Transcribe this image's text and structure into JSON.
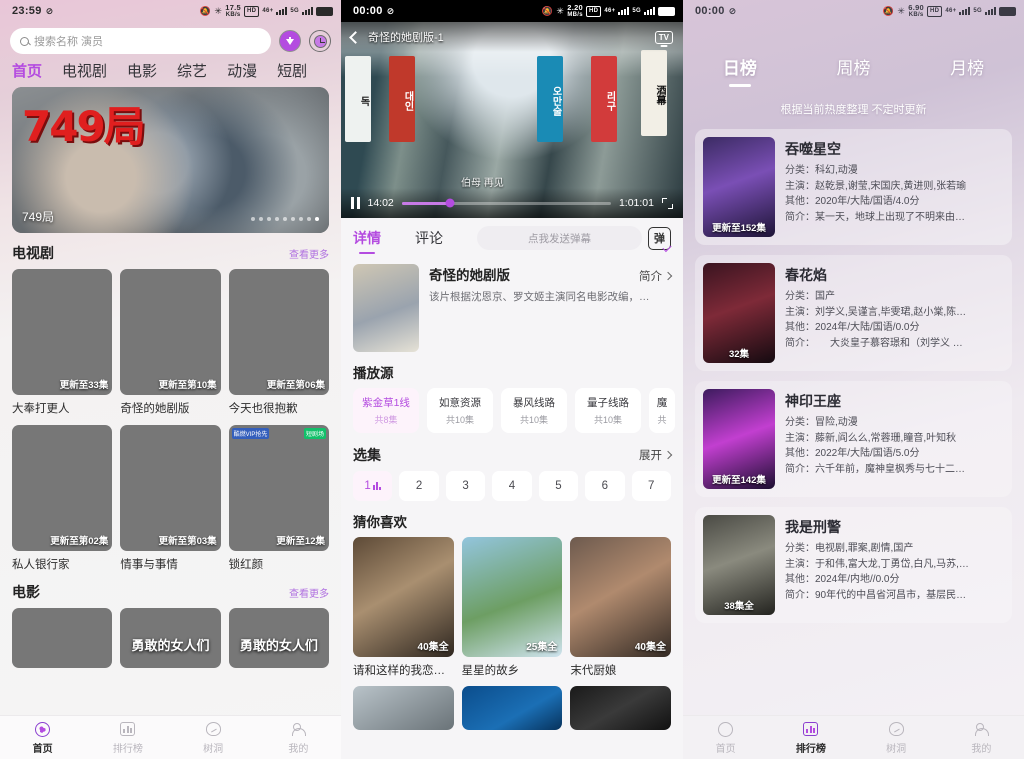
{
  "home": {
    "status": {
      "time": "23:59",
      "speed_value": "17.5",
      "speed_unit": "KB/s",
      "hd": "HD",
      "sig1": "46+",
      "sig2": "5G"
    },
    "search": {
      "placeholder": "搜索名称 演员"
    },
    "icons": {
      "download": "download-circle-icon",
      "history": "history-clock-icon"
    },
    "tabs": [
      {
        "label": "首页",
        "active": true
      },
      {
        "label": "电视剧",
        "active": false
      },
      {
        "label": "电影",
        "active": false
      },
      {
        "label": "综艺",
        "active": false
      },
      {
        "label": "动漫",
        "active": false
      },
      {
        "label": "短剧",
        "active": false
      }
    ],
    "banner": {
      "logo": "749局",
      "caption": "749局",
      "dots_total": 9,
      "dots_active_index": 8
    },
    "sections": [
      {
        "title": "电视剧",
        "more": "查看更多",
        "rows": [
          [
            {
              "name": "大奉打更人",
              "badge": "更新至33集",
              "corner": "",
              "corner_right": ""
            },
            {
              "name": "奇怪的她剧版",
              "badge": "更新至第10集",
              "corner": "",
              "corner_right": ""
            },
            {
              "name": "今天也很抱歉",
              "badge": "更新至第06集",
              "corner": "",
              "corner_right": ""
            }
          ],
          [
            {
              "name": "私人银行家",
              "badge": "更新至第02集",
              "corner": "",
              "corner_right": ""
            },
            {
              "name": "情事与事情",
              "badge": "更新至第03集",
              "corner": "",
              "corner_right": ""
            },
            {
              "name": "锁红颜",
              "badge": "更新至12集",
              "corner": "酷燃VIP抢先",
              "corner_right": "短剧场"
            }
          ]
        ]
      },
      {
        "title": "电影",
        "more": "查看更多",
        "rows": [
          [
            {
              "name": "",
              "badge": "",
              "corner": "",
              "corner_right": ""
            },
            {
              "name": "",
              "badge": "",
              "corner": "",
              "corner_right": "",
              "poster_title": "勇敢的女人们"
            },
            {
              "name": "",
              "badge": "",
              "corner": "",
              "corner_right": "",
              "poster_title": "勇敢的女人们"
            }
          ]
        ]
      }
    ],
    "tabbar": [
      {
        "label": "首页",
        "icon": "home-icon",
        "active": true
      },
      {
        "label": "排行榜",
        "icon": "chart-icon",
        "active": false
      },
      {
        "label": "树洞",
        "icon": "tree-hole-icon",
        "active": false
      },
      {
        "label": "我的",
        "icon": "user-icon",
        "active": false
      }
    ]
  },
  "player": {
    "status": {
      "time": "00:00",
      "speed_value": "2.20",
      "speed_unit": "MB/s",
      "hd": "HD",
      "sig1": "46+",
      "sig2": "5G"
    },
    "video": {
      "title": "奇怪的她剧版-1",
      "cast_label": "TV",
      "danmaku_overlay": "伯母 再见",
      "current_time": "14:02",
      "duration": "1:01:01",
      "progress_percent": 23,
      "state": "paused"
    },
    "tabs": [
      {
        "label": "详情",
        "active": true
      },
      {
        "label": "评论",
        "active": false
      }
    ],
    "danmaku_input": {
      "placeholder": "点我发送弹幕",
      "button": "弹"
    },
    "show": {
      "title": "奇怪的她剧版",
      "more_label": "简介",
      "desc": "该片根据沈恩京、罗文姬主演同名电影改编，…"
    },
    "sources": {
      "title": "播放源",
      "items": [
        {
          "name": "紫金草1线",
          "count": "共8集",
          "selected": true
        },
        {
          "name": "如意资源",
          "count": "共10集",
          "selected": false
        },
        {
          "name": "暴风线路",
          "count": "共10集",
          "selected": false
        },
        {
          "name": "量子线路",
          "count": "共10集",
          "selected": false
        },
        {
          "name": "魔",
          "count": "共",
          "selected": false
        }
      ]
    },
    "episodes": {
      "title": "选集",
      "expand_label": "展开",
      "items": [
        {
          "label": "1",
          "playing": true
        },
        {
          "label": "2",
          "playing": false
        },
        {
          "label": "3",
          "playing": false
        },
        {
          "label": "4",
          "playing": false
        },
        {
          "label": "5",
          "playing": false
        },
        {
          "label": "6",
          "playing": false
        },
        {
          "label": "7",
          "playing": false
        }
      ]
    },
    "recommend": {
      "title": "猜你喜欢",
      "items": [
        {
          "name": "请和这样的我恋…",
          "badge": "40集全"
        },
        {
          "name": "星星的故乡",
          "badge": "25集全"
        },
        {
          "name": "末代厨娘",
          "badge": "40集全"
        }
      ]
    }
  },
  "ranking": {
    "status": {
      "time": "00:00",
      "speed_value": "6.90",
      "speed_unit": "KB/s",
      "hd": "HD",
      "sig1": "46+",
      "sig2": "5G"
    },
    "tabs": [
      {
        "label": "日榜",
        "active": true
      },
      {
        "label": "周榜",
        "active": false
      },
      {
        "label": "月榜",
        "active": false
      }
    ],
    "subtitle": "根据当前热度整理 不定时更新",
    "labels": {
      "category": "分类：",
      "cast": "主演：",
      "other": "其他：",
      "summary": "简介："
    },
    "items": [
      {
        "title": "吞噬星空",
        "episode_badge": "更新至152集",
        "category": "科幻,动漫",
        "cast": "赵乾景,谢莹,宋国庆,黄进则,张若瑜",
        "other": "2020年/大陆/国语/4.0分",
        "summary": "某一天，地球上出现了不明来由…"
      },
      {
        "title": "春花焰",
        "episode_badge": "32集",
        "category": "国产",
        "cast": "刘学义,吴谨言,毕雯珺,赵小棠,陈…",
        "other": "2024年/大陆/国语/0.0分",
        "summary": "　　大炎皇子慕容璟和（刘学义 …"
      },
      {
        "title": "神印王座",
        "episode_badge": "更新至142集",
        "category": "冒险,动漫",
        "cast": "藤新,阎么么,常蓉珊,瞳音,叶知秋",
        "other": "2022年/大陆/国语/5.0分",
        "summary": "六千年前，魔神皇枫秀与七十二…"
      },
      {
        "title": "我是刑警",
        "episode_badge": "38集全",
        "category": "电视剧,罪案,剧情,国产",
        "cast": "于和伟,富大龙,丁勇岱,白凡,马苏,…",
        "other": "2024年/内地//0.0分",
        "summary": "90年代的中昌省河昌市，基层民…"
      }
    ],
    "tabbar": [
      {
        "label": "首页",
        "icon": "home-icon",
        "active": false
      },
      {
        "label": "排行榜",
        "icon": "chart-icon",
        "active": true
      },
      {
        "label": "树洞",
        "icon": "tree-hole-icon",
        "active": false
      },
      {
        "label": "我的",
        "icon": "user-icon",
        "active": false
      }
    ]
  }
}
